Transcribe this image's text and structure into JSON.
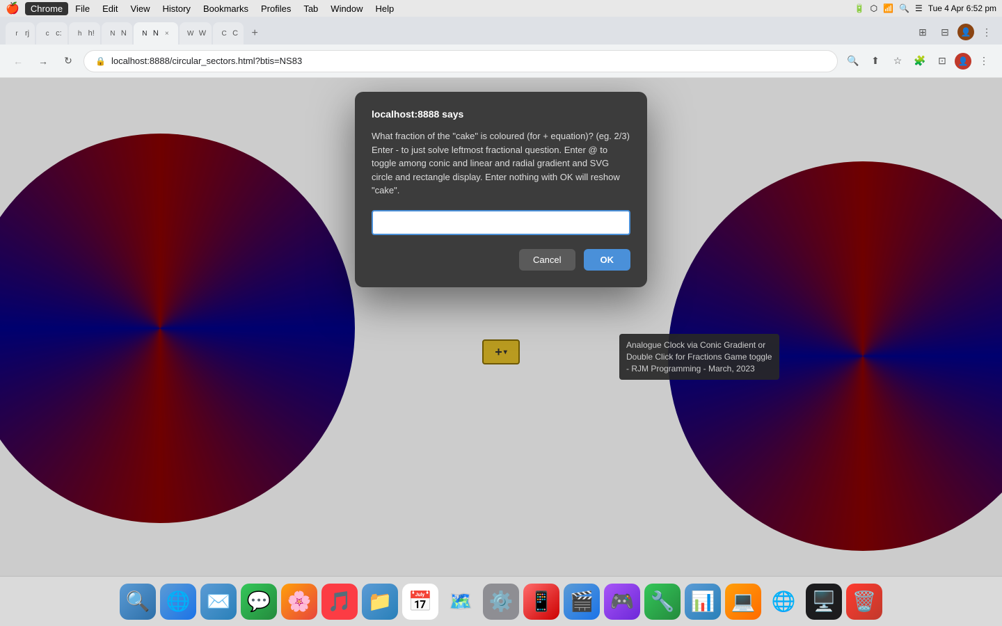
{
  "menubar": {
    "apple": "🍎",
    "items": [
      "Chrome",
      "File",
      "Edit",
      "View",
      "History",
      "Bookmarks",
      "Profiles",
      "Tab",
      "Window",
      "Help"
    ],
    "active_item": "Chrome",
    "right": "Tue 4 Apr  6:52 pm"
  },
  "browser": {
    "url": "localhost:8888/circular_sectors.html?btis=NS83",
    "tabs": [
      {
        "label": "rj",
        "active": false
      },
      {
        "label": "c:",
        "active": false
      },
      {
        "label": "h!",
        "active": false
      },
      {
        "label": "N",
        "active": false
      },
      {
        "label": "N",
        "active": true
      },
      {
        "label": "W",
        "active": false
      },
      {
        "label": "C",
        "active": false
      }
    ]
  },
  "dialog": {
    "title": "localhost:8888 says",
    "message": "What fraction of the \"cake\" is coloured (for + equation)?  (eg. 2/3)\nEnter - to just solve leftmost fractional question.  Enter @ to toggle\namong conic and linear and radial gradient and SVG circle and\nrectangle display.  Enter nothing with OK will reshow \"cake\".",
    "input_placeholder": "",
    "cancel_label": "Cancel",
    "ok_label": "OK"
  },
  "tooltip": {
    "text": "Analogue Clock via Conic Gradient or Double Click for Fractions Game toggle - RJM Programming - March, 2023"
  },
  "center_button": {
    "symbol": "+ ▾"
  },
  "dock": {
    "items": [
      "🔍",
      "🌐",
      "📧",
      "💬",
      "📷",
      "🎵",
      "📁",
      "📅",
      "🗺️",
      "🎛️",
      "📱",
      "🎬",
      "🎮",
      "🔧",
      "📊",
      "🖥️",
      "🎨"
    ]
  }
}
